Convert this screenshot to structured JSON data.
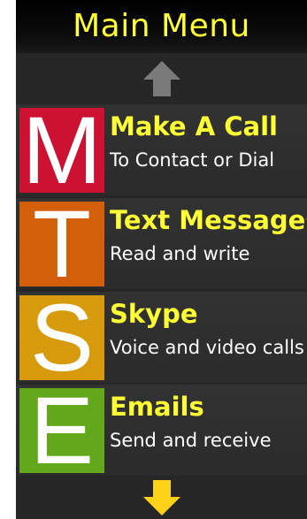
{
  "header": {
    "title": "Main Menu"
  },
  "scroll_up": {
    "icon": "arrow-up-icon",
    "color": "#7a7a7a"
  },
  "menu": {
    "items": [
      {
        "letter": "M",
        "title": "Make A Call",
        "subtitle": "To Contact or Dial",
        "tile_color": "#cc1133"
      },
      {
        "letter": "T",
        "title": "Text Messages",
        "subtitle": "Read and write",
        "tile_color": "#d45f0a"
      },
      {
        "letter": "S",
        "title": "Skype",
        "subtitle": "Voice and video calls",
        "tile_color": "#d69a0c"
      },
      {
        "letter": "E",
        "title": "Emails",
        "subtitle": "Send and receive",
        "tile_color": "#63a81a"
      }
    ]
  },
  "scroll_down": {
    "icon": "arrow-down-icon",
    "color": "#ffd21a"
  },
  "colors": {
    "accent_text": "#ffff33",
    "background": "#262626",
    "body_text": "#ffffff"
  }
}
